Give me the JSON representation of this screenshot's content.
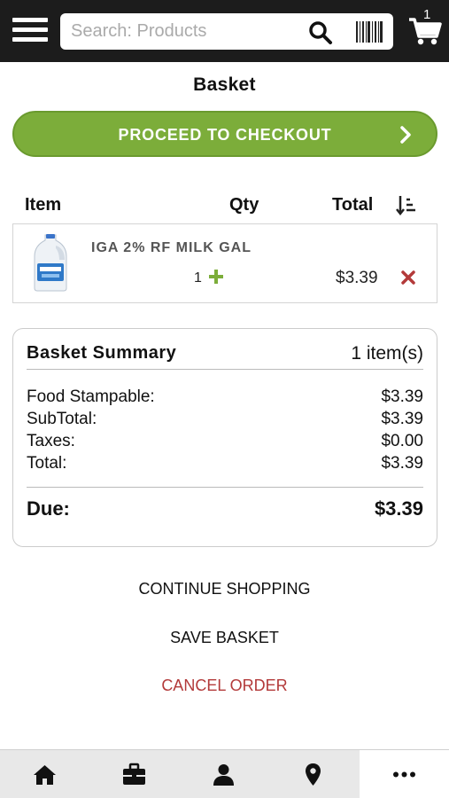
{
  "header": {
    "search_placeholder": "Search: Products",
    "cart_count": "1"
  },
  "page": {
    "title": "Basket"
  },
  "checkout": {
    "label": "PROCEED TO CHECKOUT"
  },
  "table": {
    "headers": {
      "item": "Item",
      "qty": "Qty",
      "total": "Total"
    },
    "rows": [
      {
        "name": "IGA 2% RF MILK GAL",
        "qty": "1",
        "total": "$3.39"
      }
    ]
  },
  "summary": {
    "title": "Basket Summary",
    "count": "1 item(s)",
    "lines": [
      {
        "label": "Food Stampable:",
        "value": "$3.39"
      },
      {
        "label": "SubTotal:",
        "value": "$3.39"
      },
      {
        "label": "Taxes:",
        "value": "$0.00"
      },
      {
        "label": "Total:",
        "value": "$3.39"
      }
    ],
    "due_label": "Due:",
    "due_value": "$3.39"
  },
  "actions": {
    "continue": "CONTINUE SHOPPING",
    "save": "SAVE BASKET",
    "cancel": "CANCEL ORDER"
  },
  "nav": {
    "items": [
      "home-icon",
      "briefcase-icon",
      "user-icon",
      "location-pin-icon",
      "more-icon"
    ],
    "active": "more-icon"
  },
  "colors": {
    "accent_green": "#7cad3a",
    "cancel_red": "#b33a3a",
    "topbar": "#1c1c1c"
  }
}
